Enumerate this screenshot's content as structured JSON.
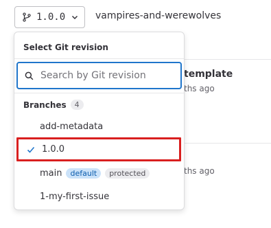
{
  "toolbar": {
    "revision_label": "1.0.0",
    "project_name": "vampires-and-werewolves"
  },
  "background": {
    "title_fragment": "template",
    "meta_fragment_1": "ths ago",
    "meta_fragment_2": "ths ago"
  },
  "dropdown": {
    "header": "Select Git revision",
    "search_placeholder": "Search by Git revision",
    "branches_label": "Branches",
    "branches_count": "4",
    "items": [
      {
        "label": "add-metadata",
        "selected": false
      },
      {
        "label": "1.0.0",
        "selected": true
      },
      {
        "label": "main",
        "selected": false,
        "badges": [
          "default",
          "protected"
        ]
      },
      {
        "label": "1-my-first-issue",
        "selected": false
      }
    ]
  },
  "colors": {
    "focus_border": "#1f75cb",
    "highlight_box": "#d91f1f",
    "default_badge_bg": "#cbe2f9",
    "protected_badge_bg": "#ececef"
  },
  "icons": {
    "revision_button": "branch-icon",
    "dropdown_toggle": "chevron-down-icon",
    "search": "search-icon",
    "selected": "check-icon"
  }
}
